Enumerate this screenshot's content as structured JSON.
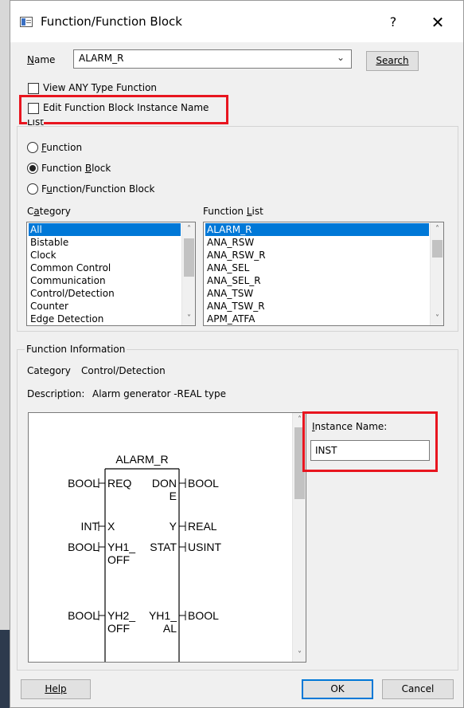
{
  "window": {
    "title": "Function/Function Block",
    "help_glyph": "?",
    "close_glyph": "✕"
  },
  "name_row": {
    "label": "Name",
    "value": "ALARM_R",
    "search_label": "Search"
  },
  "checkboxes": {
    "view_any_type": {
      "label": "View ANY Type Function",
      "checked": false
    },
    "edit_instance_name": {
      "label": "Edit Function Block Instance Name",
      "checked": false
    }
  },
  "list_group": {
    "title": "List",
    "radios": [
      {
        "label": "Function",
        "selected": false
      },
      {
        "label": "Function Block",
        "selected": true
      },
      {
        "label": "Function/Function Block",
        "selected": false
      }
    ],
    "category_label": "Category",
    "function_list_label": "Function List",
    "categories": [
      "All",
      "Bistable",
      "Clock",
      "Common Control",
      "Communication",
      "Control/Detection",
      "Counter",
      "Edge Detection"
    ],
    "functions": [
      "ALARM_R",
      "ANA_RSW",
      "ANA_RSW_R",
      "ANA_SEL",
      "ANA_SEL_R",
      "ANA_TSW",
      "ANA_TSW_R",
      "APM_ATFA"
    ]
  },
  "info_group": {
    "title": "Function Information",
    "category_label": "Category",
    "category_value": "Control/Detection",
    "description_label": "Description:",
    "description_value": "Alarm generator -REAL type"
  },
  "block": {
    "name": "ALARM_R",
    "rows": [
      {
        "in_type": "BOOL",
        "in_pin": [
          "REQ"
        ],
        "out_pin": [
          "DON",
          "E"
        ],
        "out_type": "BOOL"
      },
      {
        "in_type": "INT",
        "in_pin": [
          "X"
        ],
        "out_pin": [
          "Y"
        ],
        "out_type": "REAL"
      },
      {
        "in_type": "BOOL",
        "in_pin": [
          "YH1_",
          "OFF"
        ],
        "out_pin": [
          "STAT"
        ],
        "out_type": "USINT"
      },
      {
        "in_type": "BOOL",
        "in_pin": [
          "YH2_",
          "OFF"
        ],
        "out_pin": [
          "YH1_",
          "AL"
        ],
        "out_type": "BOOL"
      }
    ]
  },
  "instance": {
    "label": "Instance Name:",
    "value": "INST"
  },
  "buttons": {
    "help": "Help",
    "ok": "OK",
    "cancel": "Cancel"
  },
  "colors": {
    "accent": "#0078d7",
    "highlight_red": "#e8151f"
  }
}
